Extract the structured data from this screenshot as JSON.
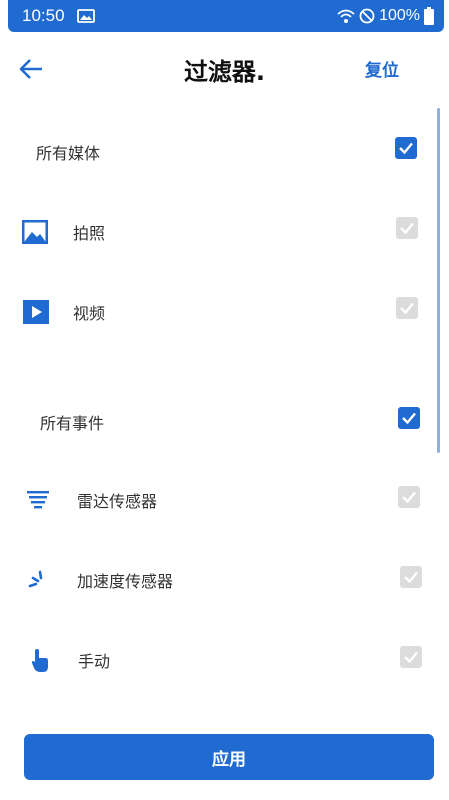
{
  "status_bar": {
    "time": "10:50",
    "battery": "100%"
  },
  "header": {
    "title": "过滤器.",
    "reset_label": "复位"
  },
  "media": {
    "all_label": "所有媒体",
    "items": [
      {
        "label": "拍照",
        "icon": "photo-icon"
      },
      {
        "label": "视频",
        "icon": "video-icon"
      }
    ]
  },
  "events": {
    "all_label": "所有事件",
    "items": [
      {
        "label": "雷达传感器",
        "icon": "radar-icon"
      },
      {
        "label": "加速度传感器",
        "icon": "accelerometer-icon"
      },
      {
        "label": "手动",
        "icon": "hand-tap-icon"
      }
    ]
  },
  "apply_label": "应用",
  "colors": {
    "accent": "#1f6bd1",
    "checkbox_disabled": "#dcdcdc"
  }
}
